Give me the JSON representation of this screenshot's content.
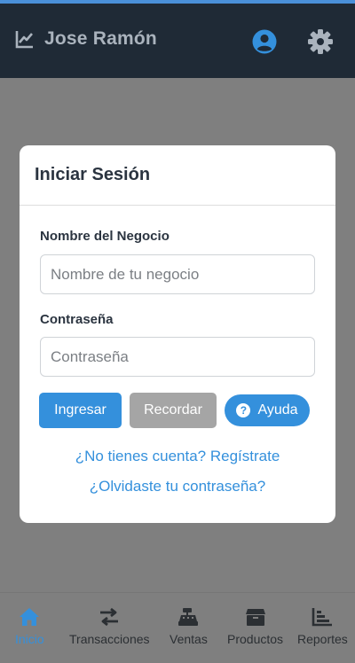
{
  "colors": {
    "accent": "#3490dc",
    "appbar": "#1f2a36",
    "overlay": "#7f7f7f",
    "secondary": "#a5a5a5"
  },
  "header": {
    "title": "Jose Ramón",
    "icons": [
      "chart-line-icon",
      "user-circle-icon",
      "gear-icon"
    ]
  },
  "login": {
    "title": "Iniciar Sesión",
    "business_label": "Nombre del Negocio",
    "business_placeholder": "Nombre de tu negocio",
    "password_label": "Contraseña",
    "password_placeholder": "Contraseña",
    "buttons": {
      "login": "Ingresar",
      "remind": "Recordar",
      "help": "Ayuda"
    },
    "help_icon_glyph": "?",
    "register_link": "¿No tienes cuenta? Regístrate",
    "forgot_link": "¿Olvidaste tu contraseña?"
  },
  "bottom_nav": {
    "items": [
      {
        "label": "Inicio",
        "icon": "home-icon",
        "active": true
      },
      {
        "label": "Transacciones",
        "icon": "exchange-icon",
        "active": false
      },
      {
        "label": "Ventas",
        "icon": "cash-register-icon",
        "active": false
      },
      {
        "label": "Productos",
        "icon": "box-icon",
        "active": false
      },
      {
        "label": "Reportes",
        "icon": "chart-bar-icon",
        "active": false
      }
    ]
  }
}
